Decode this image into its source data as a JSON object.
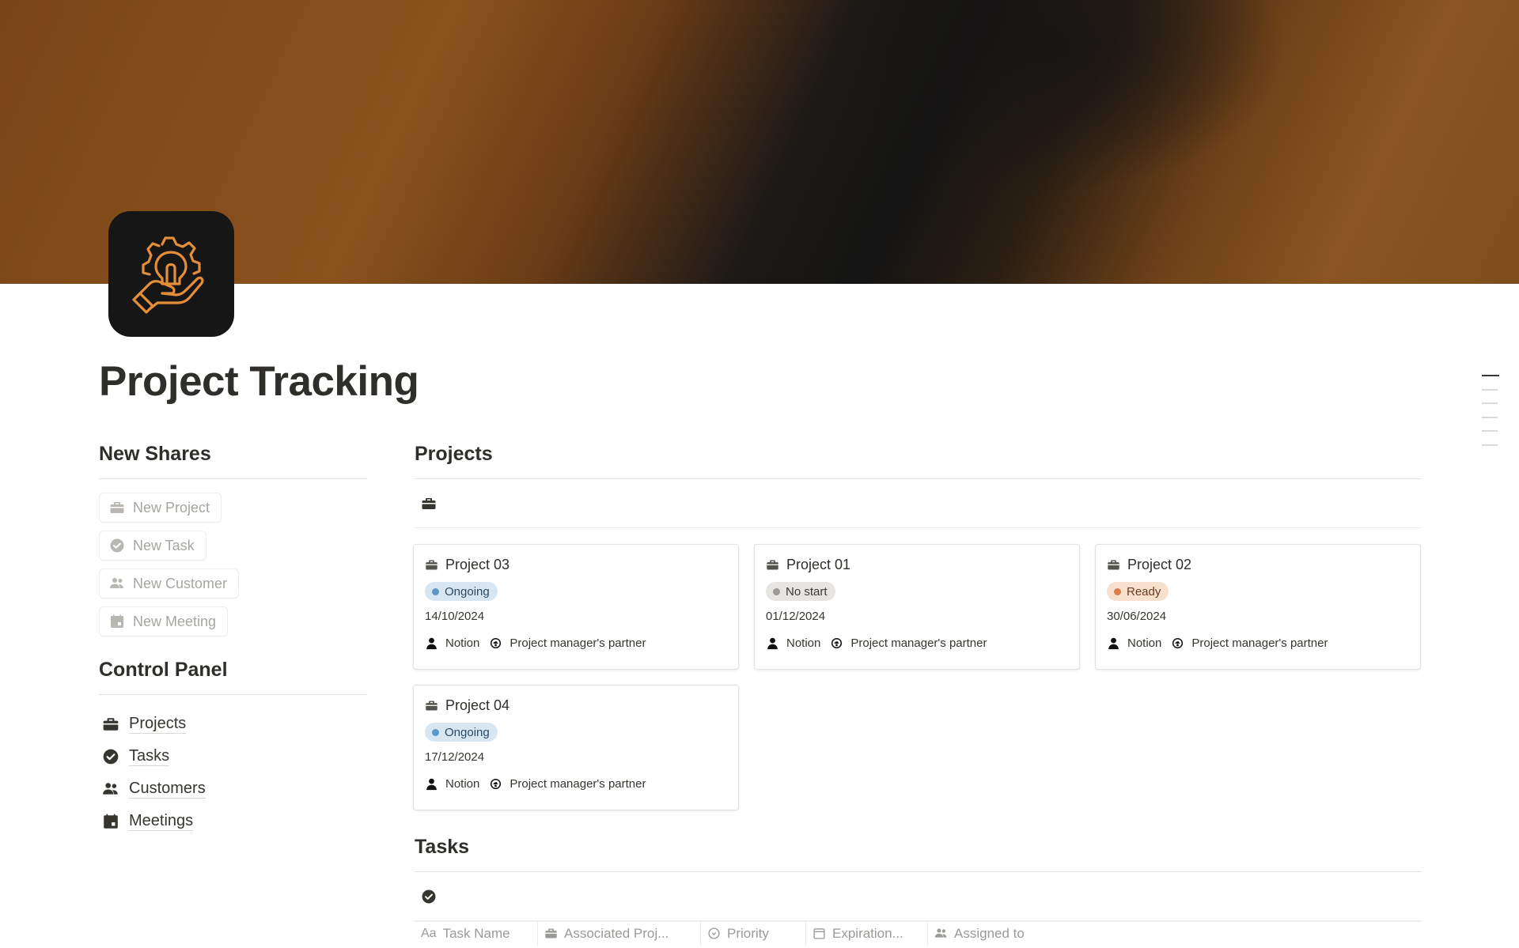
{
  "page": {
    "title": "Project Tracking",
    "icon": "gear-lightbulb-hand-icon",
    "accent": "#e58e3a"
  },
  "new_shares": {
    "heading": "New Shares",
    "buttons": [
      {
        "label": "New Project",
        "icon": "briefcase-icon"
      },
      {
        "label": "New Task",
        "icon": "check-circle-icon"
      },
      {
        "label": "New Customer",
        "icon": "people-icon"
      },
      {
        "label": "New Meeting",
        "icon": "calendar-icon"
      }
    ]
  },
  "control_panel": {
    "heading": "Control Panel",
    "items": [
      {
        "label": "Projects",
        "icon": "briefcase-icon"
      },
      {
        "label": "Tasks",
        "icon": "check-circle-icon"
      },
      {
        "label": "Customers",
        "icon": "people-icon"
      },
      {
        "label": "Meetings",
        "icon": "calendar-icon"
      }
    ]
  },
  "projects": {
    "heading": "Projects",
    "cards": [
      {
        "name": "Project 03",
        "status": "Ongoing",
        "status_color": "blue",
        "date": "14/10/2024",
        "owner": "Notion",
        "partner": "Project manager's partner"
      },
      {
        "name": "Project 01",
        "status": "No start",
        "status_color": "gray",
        "date": "01/12/2024",
        "owner": "Notion",
        "partner": "Project manager's partner"
      },
      {
        "name": "Project 02",
        "status": "Ready",
        "status_color": "orange",
        "date": "30/06/2024",
        "owner": "Notion",
        "partner": "Project manager's partner"
      },
      {
        "name": "Project 04",
        "status": "Ongoing",
        "status_color": "blue",
        "date": "17/12/2024",
        "owner": "Notion",
        "partner": "Project manager's partner"
      }
    ]
  },
  "tasks": {
    "heading": "Tasks",
    "columns": [
      {
        "label": "Task Name",
        "icon": "text-aa-icon"
      },
      {
        "label": "Associated Proj...",
        "icon": "briefcase-icon"
      },
      {
        "label": "Priority",
        "icon": "status-icon"
      },
      {
        "label": "Expiration...",
        "icon": "calendar-icon"
      },
      {
        "label": "Assigned to",
        "icon": "people-icon"
      }
    ]
  }
}
